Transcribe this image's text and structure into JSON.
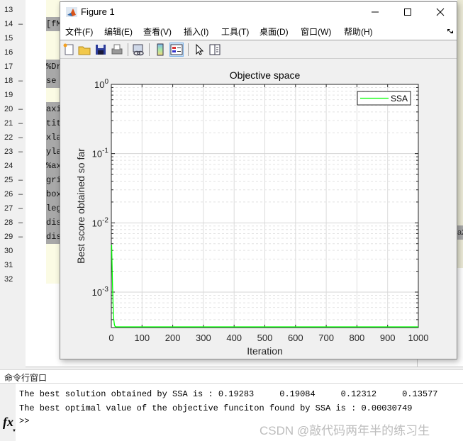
{
  "editor": {
    "line_numbers": [
      {
        "n": "13",
        "dash": false
      },
      {
        "n": "14",
        "dash": true
      },
      {
        "n": "15",
        "dash": false
      },
      {
        "n": "16",
        "dash": false
      },
      {
        "n": "17",
        "dash": false
      },
      {
        "n": "18",
        "dash": true
      },
      {
        "n": "19",
        "dash": false
      },
      {
        "n": "20",
        "dash": true
      },
      {
        "n": "21",
        "dash": true
      },
      {
        "n": "22",
        "dash": true
      },
      {
        "n": "23",
        "dash": true
      },
      {
        "n": "24",
        "dash": false
      },
      {
        "n": "25",
        "dash": true
      },
      {
        "n": "26",
        "dash": true
      },
      {
        "n": "27",
        "dash": true
      },
      {
        "n": "28",
        "dash": true
      },
      {
        "n": "29",
        "dash": true
      },
      {
        "n": "30",
        "dash": false
      },
      {
        "n": "31",
        "dash": false
      },
      {
        "n": "32",
        "dash": false
      }
    ],
    "code_fragments": [
      "",
      "[fM",
      "",
      "",
      "%Dr",
      " se",
      "",
      "axi",
      "tit",
      "xla",
      "yla",
      "%ax",
      "gri",
      "box",
      "leg",
      "dis",
      "dis",
      "",
      "",
      ""
    ],
    "right_fragment": "a2"
  },
  "figure": {
    "title": "Figure 1",
    "window_controls": {
      "minimize": "—",
      "maximize": "☐",
      "close": "✕"
    },
    "menu": [
      "文件(F)",
      "编辑(E)",
      "查看(V)",
      "插入(I)",
      "工具(T)",
      "桌面(D)",
      "窗口(W)",
      "帮助(H)"
    ],
    "toolbar_icons": [
      "new-figure-icon",
      "open-file-icon",
      "save-icon",
      "print-icon",
      "link-plot-icon",
      "colorbar-icon",
      "legend-icon",
      "pointer-icon",
      "property-editor-icon"
    ]
  },
  "chart_data": {
    "type": "line",
    "title": "Objective space",
    "xlabel": "Iteration",
    "ylabel": "Best score obtained so far",
    "xlim": [
      0,
      1000
    ],
    "ylim": [
      0.00030749,
      1
    ],
    "yscale": "log",
    "grid": true,
    "minor_grid": true,
    "x_ticks": [
      "0",
      "100",
      "200",
      "300",
      "400",
      "500",
      "600",
      "700",
      "800",
      "900",
      "1000"
    ],
    "y_ticks": [
      {
        "base": "10",
        "exp": "0"
      },
      {
        "base": "10",
        "exp": "-1"
      },
      {
        "base": "10",
        "exp": "-2"
      },
      {
        "base": "10",
        "exp": "-3"
      }
    ],
    "legend": {
      "entries": [
        "SSA"
      ],
      "placement": "top-right"
    },
    "series": [
      {
        "name": "SSA",
        "color": "#00ff00",
        "x": [
          1,
          2,
          3,
          4,
          5,
          6,
          7,
          8,
          10,
          12,
          15,
          20,
          50,
          100,
          200,
          500,
          1000
        ],
        "y": [
          0.0048,
          0.003,
          0.0019,
          0.0012,
          0.00085,
          0.0006,
          0.00047,
          0.0004,
          0.00034,
          0.00032,
          0.000312,
          0.0003078,
          0.00030749,
          0.00030749,
          0.00030749,
          0.00030749,
          0.00030749
        ]
      }
    ]
  },
  "command_window": {
    "header": "命令行窗口",
    "lines": [
      "The best solution obtained by SSA is : 0.19283     0.19084     0.12312     0.13577",
      "The best optimal value of the objective funciton found by SSA is : 0.00030749"
    ],
    "prompt": ">>",
    "fx_label": "fx"
  },
  "watermark": "CSDN @敲代码两年半的练习生"
}
